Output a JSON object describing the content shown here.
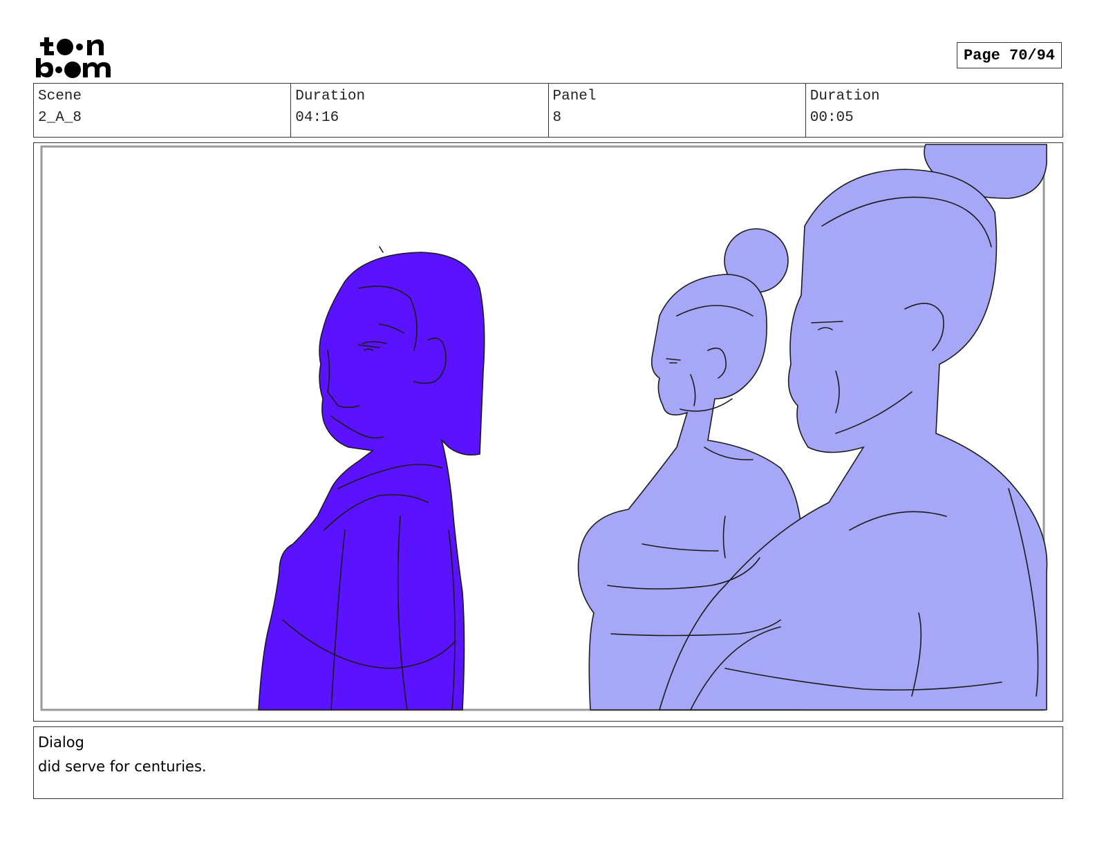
{
  "header": {
    "logo_text": "toon boom",
    "page_label": "Page 70/94"
  },
  "info": {
    "scene_label": "Scene",
    "scene_value": "2_A_8",
    "duration_label": "Duration",
    "duration_value": "04:16",
    "panel_label": "Panel",
    "panel_value": "8",
    "panel_duration_label": "Duration",
    "panel_duration_value": "00:05"
  },
  "panel": {
    "colors": {
      "foreground_character": "#5a12ff",
      "background_characters": "#a6a8f7",
      "line": "#1a1a1a",
      "frame": "#9a9a9a"
    }
  },
  "dialog": {
    "label": "Dialog",
    "text": "did serve for centuries."
  }
}
